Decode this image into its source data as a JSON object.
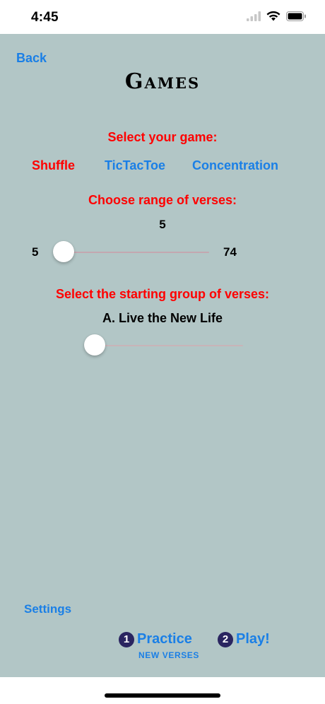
{
  "status_bar": {
    "time": "4:45",
    "icons": [
      "signal-icon",
      "wifi-icon",
      "battery-icon"
    ]
  },
  "nav": {
    "back_label": "Back"
  },
  "page": {
    "title": "Games"
  },
  "game_select": {
    "label": "Select your game:",
    "options": [
      {
        "label": "Shuffle",
        "selected": true,
        "color": "#ff0000"
      },
      {
        "label": "TicTacToe",
        "selected": false,
        "color": "#1a7fe6"
      },
      {
        "label": "Concentration",
        "selected": false,
        "color": "#1a7fe6"
      }
    ]
  },
  "range_select": {
    "label": "Choose range of verses:",
    "current_value": "5",
    "min_label": "5",
    "max_label": "74",
    "min": 5,
    "max": 74,
    "value": 5
  },
  "group_select": {
    "label": "Select the starting group of verses:",
    "current_group": "A. Live the New Life",
    "level": 0
  },
  "footer": {
    "settings_label": "Settings",
    "practice": {
      "number": "1",
      "label": "Practice"
    },
    "practice_sub_label": "NEW VERSES",
    "play": {
      "number": "2",
      "label": "Play!"
    }
  },
  "colors": {
    "background": "#b2c6c6",
    "accent_blue": "#1a7fe6",
    "accent_red": "#ff0000",
    "badge": "#2a2560"
  }
}
